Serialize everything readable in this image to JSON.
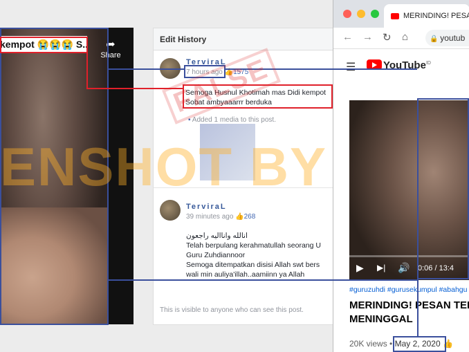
{
  "left_video": {
    "caption": "kempot 😭😭😭 S...",
    "share_label": "Share"
  },
  "edit_history": {
    "title": "Edit History",
    "entries": [
      {
        "user": "TerviraL",
        "time": "7 hours ago",
        "likes": "1575",
        "lines": [
          "Semoga Husnul Khotimah mas Didi kempot",
          "Sobat ambyaaarrr berduka"
        ],
        "media_note": "Added 1 media to this post."
      },
      {
        "user": "TerviraL",
        "time": "39 minutes ago",
        "likes": "268",
        "lines": [
          "انالله وانااليه راجعون",
          "Telah berpulang kerahmatullah seorang U",
          "Guru Zuhdiannoor",
          "Semoga ditempatkan disisi Allah swt bers",
          "wali min auliya'illah..aamiinn ya Allah"
        ]
      }
    ],
    "footer": "This is visible to anyone who can see this post."
  },
  "browser": {
    "tab_title": "MERINDING! PESAN",
    "url": "youtub",
    "youtube_logo": "YouTube",
    "region": "ID",
    "time_display": "0:06 / 13:4",
    "hashtags": "#guruzuhdi #gurusekumpul #abahgu",
    "video_title_lines": [
      "MERINDING! PESAN TER",
      "MENINGGAL"
    ],
    "views": "20K views",
    "date": "May 2, 2020"
  },
  "overlays": {
    "watermark": "ENSHOT BY",
    "stamp": "FALSE"
  },
  "colors": {
    "highlight_blue": "#3a4f9c",
    "highlight_red": "#e0202a",
    "facebook_blue": "#365899",
    "youtube_red": "#ff0000",
    "link_blue": "#065fd4"
  }
}
